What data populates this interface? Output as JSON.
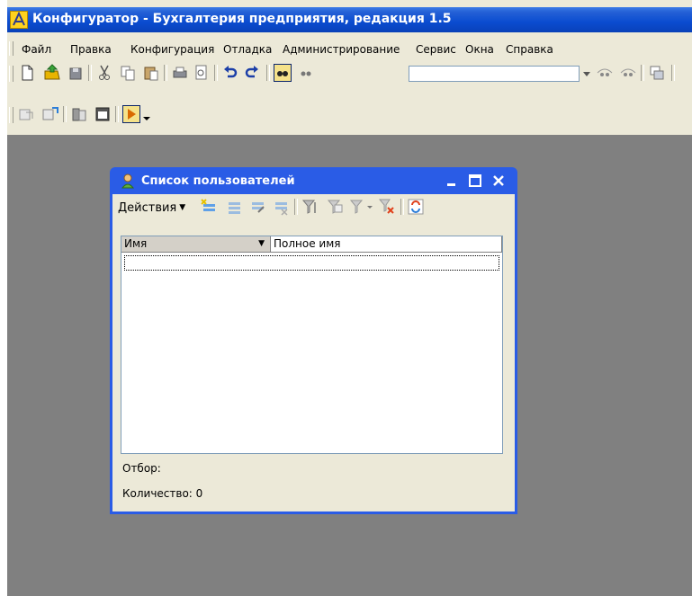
{
  "app_title": "Конфигуратор - Бухгалтерия предприятия, редакция 1.5",
  "menu": [
    {
      "label": "Файл"
    },
    {
      "label": "Правка"
    },
    {
      "label": "Конфигурация"
    },
    {
      "label": "Отладка"
    },
    {
      "label": "Администрирование"
    },
    {
      "label": "Сервис"
    },
    {
      "label": "Окна"
    },
    {
      "label": "Справка"
    }
  ],
  "toolbar": {
    "search_value": ""
  },
  "window": {
    "title": "Список пользователей",
    "actions_label": "Действия",
    "columns": [
      "Имя",
      "Полное имя"
    ],
    "rows": [],
    "filter_label": "Отбор:",
    "count_label": "Количество: 0"
  },
  "colors": {
    "titlebar": "#0a4cd0",
    "window_border": "#2a5ce6",
    "mdi_background": "#808080",
    "close_red": "#e0411b"
  }
}
